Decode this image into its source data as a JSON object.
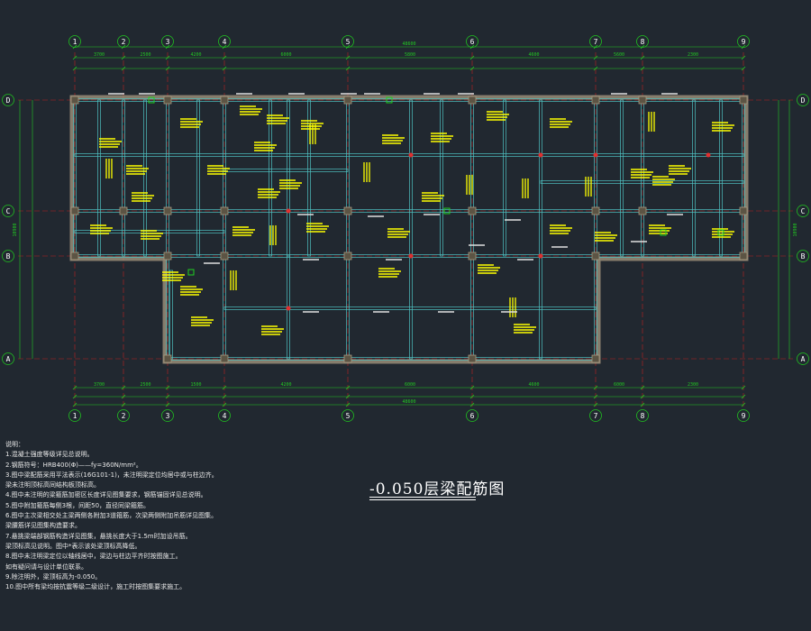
{
  "axes_vertical": [
    {
      "label": "1"
    },
    {
      "label": "2"
    },
    {
      "label": "3"
    },
    {
      "label": "4"
    },
    {
      "label": "5"
    },
    {
      "label": "6"
    },
    {
      "label": "7"
    },
    {
      "label": "8"
    },
    {
      "label": "9"
    }
  ],
  "axes_horizontal": [
    {
      "label": "D"
    },
    {
      "label": "C"
    },
    {
      "label": "B"
    },
    {
      "label": "A"
    }
  ],
  "top_total_dim": "48600",
  "bottom_total_dim": "48600",
  "top_dims": [
    "3700",
    "2500",
    "4200",
    "6000",
    "5800",
    "4600",
    "5600",
    "2300",
    "7400"
  ],
  "bottom_dims": [
    "3700",
    "2500",
    "1500",
    "4200",
    "6000",
    "4600",
    "6000",
    "2300",
    "7400"
  ],
  "left_total_dim": "10900",
  "right_total_dim": "10900",
  "colors": {
    "background": "#212830",
    "beam": "#4fc1c1",
    "grid": "#20c020",
    "dim": "#22c822",
    "label": "#ffff00",
    "redline": "#c02020",
    "wall": "#a89a80"
  },
  "notes": {
    "heading": "说明：",
    "lines": [
      "1.混凝土强度等级详见总说明。",
      "2.钢筋符号：HRB400(Φ)——fy=360N/mm²。",
      "3.图中梁配筋采用平法表示(16G101-1)，未注明梁定位均居中或与柱边齐。",
      "  梁未注明顶标高同结构板顶标高。",
      "4.图中未注明的梁箍筋加密区长度详见图集要求，钢筋锚固详见总说明。",
      "5.图中附加箍筋每侧3根，间距50，直径同梁箍筋。",
      "6.图中主次梁相交处主梁两侧各附加3道箍筋，次梁两侧附加吊筋详见图集。",
      "  梁腰筋详见图集构造要求。",
      "7.悬挑梁端部钢筋构造详见图集，悬挑长度大于1.5m时加设吊筋。",
      "  梁顶标高见说明。图中*表示该处梁顶标高降低。",
      "8.图中未注明梁定位以轴线居中，梁边与柱边平齐时按图施工。",
      "  如有疑问请与设计单位联系。",
      "9.除注明外，梁顶标高为-0.050。",
      "10.图中所有梁均按抗震等级二级设计，施工时按图集要求施工。"
    ]
  },
  "drawing_title": "-0.050层梁配筋图"
}
